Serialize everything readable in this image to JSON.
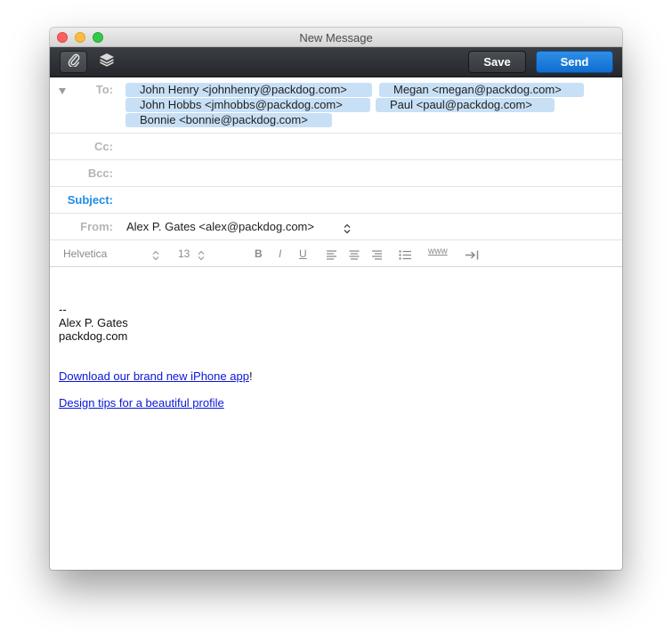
{
  "window": {
    "title": "New Message"
  },
  "toolbar": {
    "attach_icon": "paperclip-icon",
    "stack_icon": "layers-icon",
    "save_label": "Save",
    "send_label": "Send"
  },
  "header": {
    "to_label": "To:",
    "to_recipients": [
      "John Henry <johnhenry@packdog.com>",
      "Megan <megan@packdog.com>",
      "John Hobbs <jmhobbs@packdog.com>",
      "Paul <paul@packdog.com>",
      "Bonnie <bonnie@packdog.com>"
    ],
    "cc_label": "Cc:",
    "bcc_label": "Bcc:",
    "subject_label": "Subject:",
    "subject_value": "",
    "from_label": "From:",
    "from_value": "Alex P. Gates <alex@packdog.com>"
  },
  "format_bar": {
    "font_name": "Helvetica",
    "font_size": "13",
    "bold_label": "B",
    "italic_label": "I",
    "underline_label": "U",
    "link_label": "www"
  },
  "body": {
    "separator": "--",
    "signature_name": "Alex P. Gates",
    "signature_site": "packdog.com",
    "app_link_text": "Download our brand new iPhone app",
    "app_link_suffix": "!",
    "tips_link_text": "Design tips for a beautiful profile"
  },
  "colors": {
    "accent": "#1d8de6",
    "chip_bg": "#c8e0f6",
    "link": "#0b16d6",
    "toolbar": "#2c3034"
  }
}
